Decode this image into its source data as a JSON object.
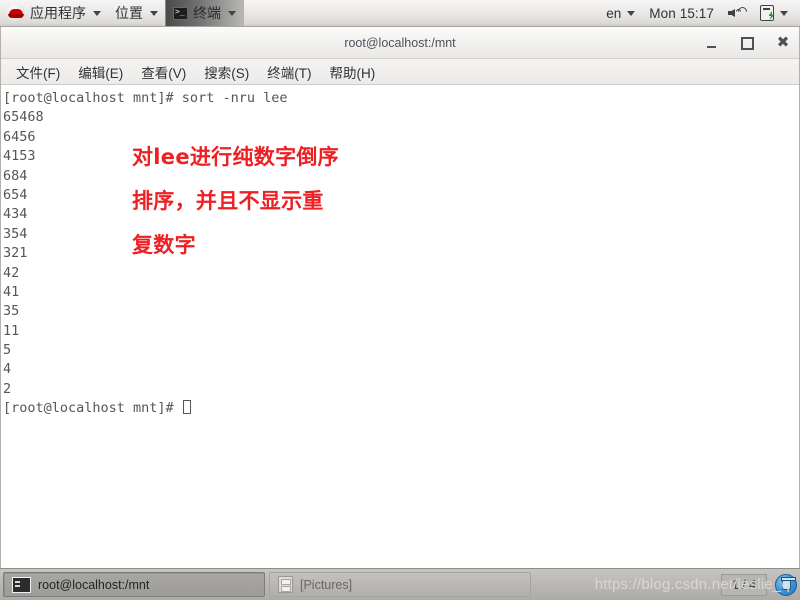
{
  "top_panel": {
    "logo_icon": "redhat-logo-icon",
    "menus": [
      {
        "label": "应用程序",
        "icon": "redhat-logo-icon",
        "has_caret": true
      },
      {
        "label": "位置",
        "has_caret": true
      },
      {
        "label": "终端",
        "icon": "terminal-icon",
        "has_caret": true,
        "active": true
      }
    ],
    "right": {
      "language": "en",
      "language_caret": true,
      "clock": "Mon 15:17",
      "volume_icon": "volume-icon",
      "power_icon": "power-battery-icon",
      "right_caret": true
    }
  },
  "window": {
    "title": "root@localhost:/mnt",
    "controls": {
      "minimize": "minimize-icon",
      "maximize": "maximize-icon",
      "close": "close-icon"
    },
    "menu_bar": [
      "文件(F)",
      "编辑(E)",
      "查看(V)",
      "搜索(S)",
      "终端(T)",
      "帮助(H)"
    ]
  },
  "terminal": {
    "prompt": "[root@localhost mnt]# ",
    "command": "sort -nru lee",
    "output_lines": [
      "65468",
      "6456",
      "4153",
      "684",
      "654",
      "434",
      "354",
      "321",
      "42",
      "41",
      "35",
      "11",
      "5",
      "4",
      "2"
    ],
    "final_prompt": "[root@localhost mnt]# ",
    "cursor": "block-cursor",
    "fg_color": "#555753",
    "bg_color": "#ffffff"
  },
  "annotation": {
    "color": "#ed2024",
    "lines": [
      "对lee进行纯数字倒序",
      "排序，并且不显示重",
      "复数字"
    ]
  },
  "taskbar": {
    "buttons": [
      {
        "label": "root@localhost:/mnt",
        "icon": "terminal-icon",
        "active": true
      },
      {
        "label": "[Pictures]",
        "icon": "file-manager-icon",
        "active": false
      }
    ],
    "workspace": "1 / 4",
    "trash_icon": "trash-icon"
  },
  "watermark": "https://blog.csdn.net/leslie_q"
}
